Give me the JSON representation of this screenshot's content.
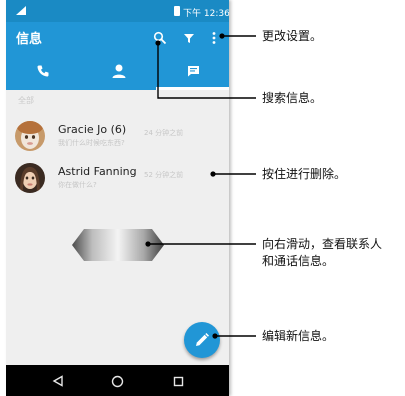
{
  "status_bar": {
    "time": "下午 12:36"
  },
  "app_bar": {
    "title": "信息"
  },
  "icons": {
    "search": "search-icon",
    "filter": "filter-icon",
    "more": "more-vert-icon",
    "phone": "phone-icon",
    "contacts": "person-icon",
    "messages": "message-icon",
    "compose": "pencil-icon",
    "back": "back-triangle-icon",
    "home": "home-circle-icon",
    "recents": "recents-square-icon"
  },
  "list": {
    "section_header": "全部",
    "rows": [
      {
        "name": "Gracie Jo (6)",
        "preview": "我们什么时候吃东西?",
        "time": "24 分钟之前"
      },
      {
        "name": "Astrid Fanning",
        "preview": "你在做什么?",
        "time": "52 分钟之前"
      }
    ]
  },
  "callouts": {
    "settings": "更改设置。",
    "search": "搜索信息。",
    "delete": "按住进行删除。",
    "swipe_line1": "向右滑动，查看联系人",
    "swipe_line2": "和通话信息。",
    "compose": "编辑新信息。"
  },
  "colors": {
    "primary": "#2196d6",
    "status_bar": "#1a8ac4",
    "list_bg": "#efefef",
    "nav_bar": "#000000"
  }
}
